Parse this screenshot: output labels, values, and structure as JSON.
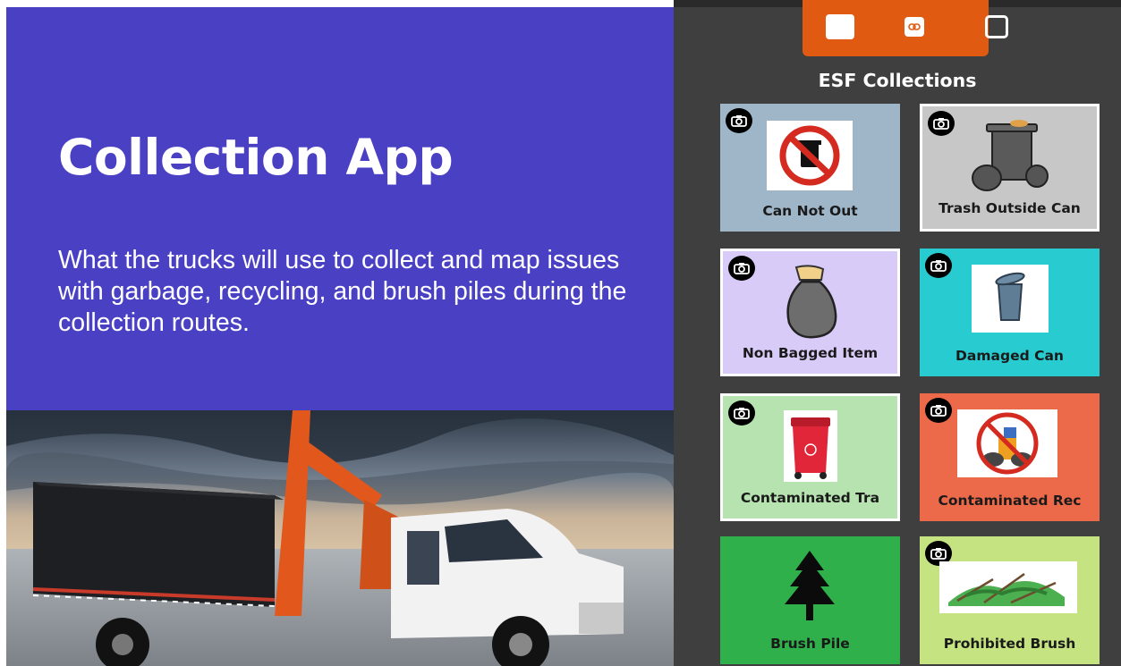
{
  "hero": {
    "title": "Collection App",
    "description": "What the trucks will use to collect and map issues with garbage, recycling, and brush piles during the collection routes."
  },
  "app": {
    "title": "ESF Collections",
    "toolbar": {
      "icons": [
        "square-icon",
        "link-icon",
        "frame-icon"
      ],
      "color": "#e05a12"
    },
    "tiles": [
      {
        "label": "Can Not Out",
        "color": "#9fb6c9",
        "icon": "no-trash-can-icon",
        "camera": true
      },
      {
        "label": "Trash Outside Can",
        "color": "#c7c7c7",
        "icon": "overflowing-trash-icon",
        "camera": true
      },
      {
        "label": "Non Bagged Item",
        "color": "#d9cbf7",
        "icon": "garbage-bag-icon",
        "camera": true
      },
      {
        "label": "Damaged Can",
        "color": "#28cbd0",
        "icon": "damaged-can-icon",
        "camera": true
      },
      {
        "label": "Contaminated Tra",
        "color": "#b6e3b0",
        "icon": "red-bin-icon",
        "camera": true
      },
      {
        "label": "Contaminated Rec",
        "color": "#ec6a4a",
        "icon": "prohibited-recycling-icon",
        "camera": true
      },
      {
        "label": "Brush Pile",
        "color": "#2fb04a",
        "icon": "tree-icon",
        "camera": false
      },
      {
        "label": "Prohibited Brush",
        "color": "#c5e381",
        "icon": "brush-debris-icon",
        "camera": true
      }
    ]
  }
}
